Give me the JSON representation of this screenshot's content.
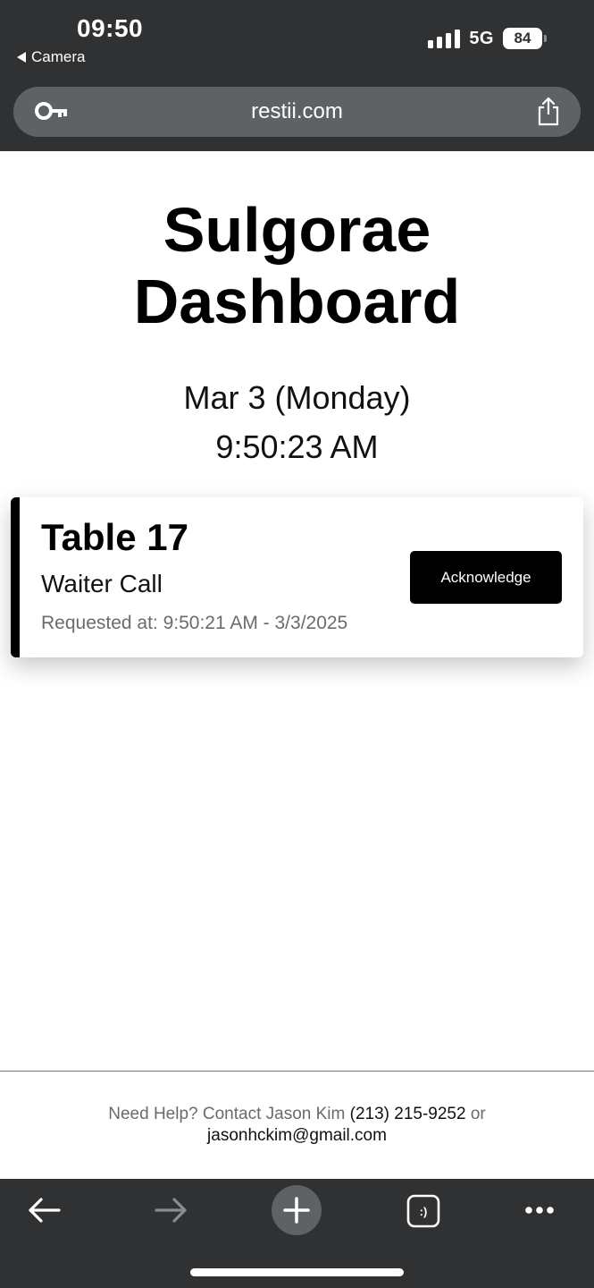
{
  "status_bar": {
    "time": "09:50",
    "back_label": "Camera",
    "network": "5G",
    "battery": "84"
  },
  "browser": {
    "url": "restii.com"
  },
  "dashboard": {
    "title_line1": "Sulgorae",
    "title_line2": "Dashboard",
    "date": "Mar 3 (Monday)",
    "clock": "9:50:23 AM"
  },
  "calls": [
    {
      "table": "Table 17",
      "type": "Waiter Call",
      "requested": "Requested at: 9:50:21 AM - 3/3/2025",
      "button_label": "Acknowledge"
    }
  ],
  "footer": {
    "prefix": "Need Help? Contact Jason Kim ",
    "phone": "(213) 215-9252",
    "joiner": " or",
    "email": "jasonhckim@gmail.com"
  },
  "toolbar": {
    "back_icon": "arrow-left-icon",
    "forward_icon": "arrow-right-icon",
    "new_tab_icon": "plus-icon",
    "tabs_icon": "tabs-icon",
    "tabs_glyph": ":)",
    "more_icon": "more-icon"
  },
  "colors": {
    "chrome": "#2f3133",
    "url_pill": "#5f6265",
    "accent": "#000000"
  }
}
